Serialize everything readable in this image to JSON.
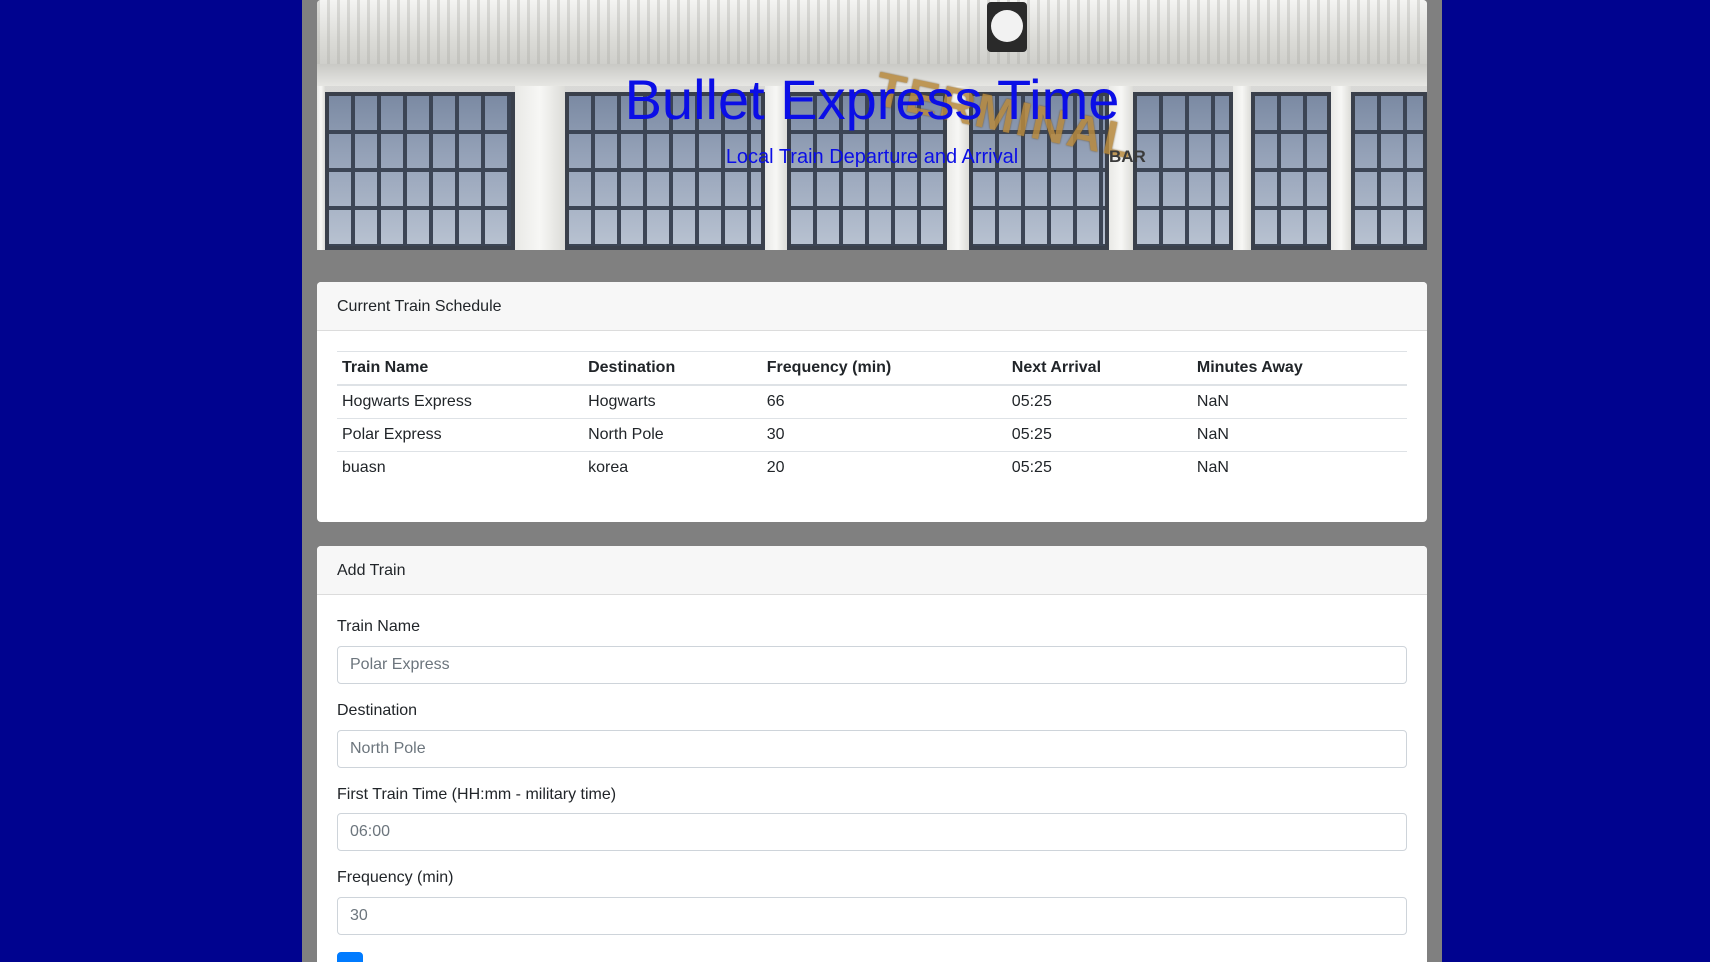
{
  "hero": {
    "title": "Bullet Express Time",
    "subtitle": "Local Train Departure and Arrival",
    "sign_text": "TERMINAL",
    "bar_text": "BAR"
  },
  "schedule": {
    "header": "Current Train Schedule",
    "columns": [
      "Train Name",
      "Destination",
      "Frequency (min)",
      "Next Arrival",
      "Minutes Away"
    ],
    "rows": [
      [
        "Hogwarts Express",
        "Hogwarts",
        "66",
        "05:25",
        "NaN"
      ],
      [
        "Polar Express",
        "North Pole",
        "30",
        "05:25",
        "NaN"
      ],
      [
        "buasn",
        "korea",
        "20",
        "05:25",
        "NaN"
      ]
    ]
  },
  "add_train": {
    "header": "Add Train",
    "fields": [
      {
        "label": "Train Name",
        "placeholder": "Polar Express"
      },
      {
        "label": "Destination",
        "placeholder": "North Pole"
      },
      {
        "label": "First Train Time (HH:mm - military time)",
        "placeholder": "06:00"
      },
      {
        "label": "Frequency (min)",
        "placeholder": "30"
      }
    ]
  },
  "colors": {
    "page_background": "#00038f",
    "container_background": "#808080",
    "title_color": "#0b0ee6",
    "button_color": "#007bff"
  }
}
